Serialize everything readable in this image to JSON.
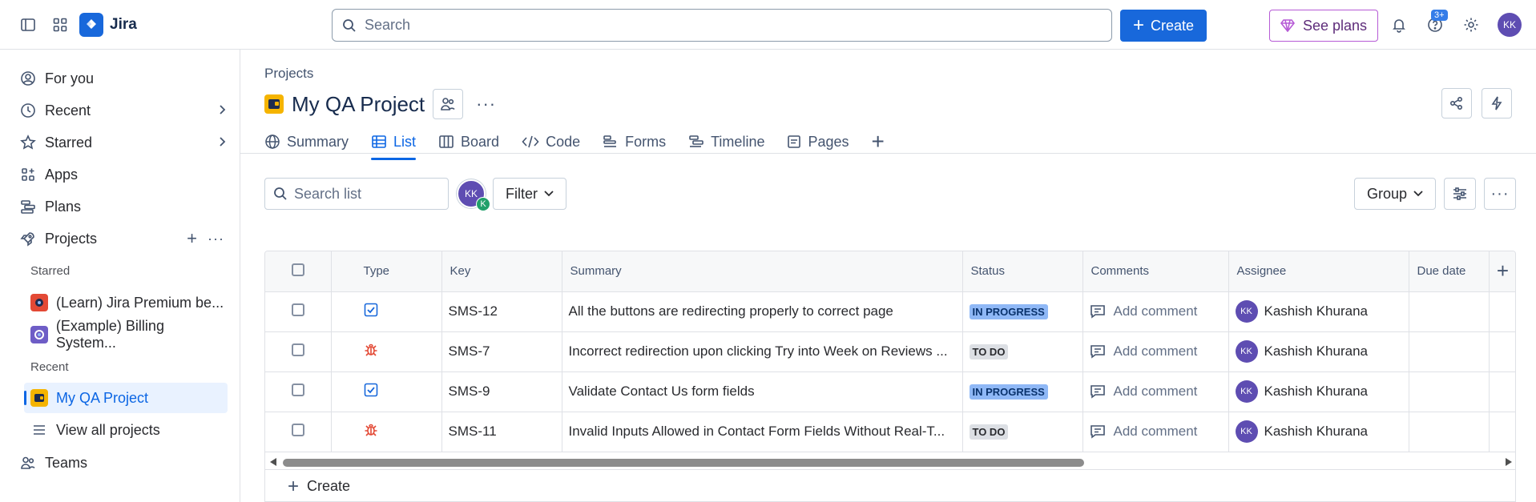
{
  "topbar": {
    "app_name": "Jira",
    "search_placeholder": "Search",
    "create_label": "Create",
    "see_plans_label": "See plans",
    "help_badge": "3+",
    "avatar_initials": "KK"
  },
  "sidebar": {
    "items": [
      {
        "label": "For you",
        "icon": "user-circle-icon"
      },
      {
        "label": "Recent",
        "icon": "clock-icon"
      },
      {
        "label": "Starred",
        "icon": "star-icon"
      },
      {
        "label": "Apps",
        "icon": "apps-icon"
      },
      {
        "label": "Plans",
        "icon": "plans-icon"
      },
      {
        "label": "Projects",
        "icon": "rocket-icon"
      }
    ],
    "starred_heading": "Starred",
    "starred": [
      {
        "label": "(Learn) Jira Premium be...",
        "color": "#e34935"
      },
      {
        "label": "(Example) Billing System...",
        "color": "#6e5dc6"
      }
    ],
    "recent_heading": "Recent",
    "recent": [
      {
        "label": "My QA Project",
        "color": "#f5b400"
      }
    ],
    "view_all": "View all projects",
    "teams": "Teams"
  },
  "main": {
    "breadcrumb": "Projects",
    "title": "My QA Project",
    "tabs": [
      {
        "label": "Summary",
        "icon": "globe-icon"
      },
      {
        "label": "List",
        "icon": "list-icon"
      },
      {
        "label": "Board",
        "icon": "board-icon"
      },
      {
        "label": "Code",
        "icon": "code-icon"
      },
      {
        "label": "Forms",
        "icon": "forms-icon"
      },
      {
        "label": "Timeline",
        "icon": "timeline-icon"
      },
      {
        "label": "Pages",
        "icon": "pages-icon"
      }
    ],
    "search_list_placeholder": "Search list",
    "filter_avatar": "KK",
    "filter_avatar_sub": "K",
    "filter_label": "Filter",
    "group_label": "Group",
    "table": {
      "columns": [
        "Type",
        "Key",
        "Summary",
        "Status",
        "Comments",
        "Assignee",
        "Due date"
      ],
      "rows": [
        {
          "type": "task",
          "key": "SMS-12",
          "summary": "All the buttons are redirecting properly to correct page",
          "status": "IN PROGRESS",
          "comment": "Add comment",
          "assignee": "Kashish Khurana",
          "initials": "KK"
        },
        {
          "type": "bug",
          "key": "SMS-7",
          "summary": "Incorrect redirection upon clicking Try into Week on Reviews ...",
          "status": "TO DO",
          "comment": "Add comment",
          "assignee": "Kashish Khurana",
          "initials": "KK"
        },
        {
          "type": "task",
          "key": "SMS-9",
          "summary": "Validate Contact Us form fields",
          "status": "IN PROGRESS",
          "comment": "Add comment",
          "assignee": "Kashish Khurana",
          "initials": "KK"
        },
        {
          "type": "bug",
          "key": "SMS-11",
          "summary": "Invalid Inputs Allowed in Contact Form Fields Without Real-T...",
          "status": "TO DO",
          "comment": "Add comment",
          "assignee": "Kashish Khurana",
          "initials": "KK"
        }
      ]
    },
    "create_label": "Create"
  }
}
